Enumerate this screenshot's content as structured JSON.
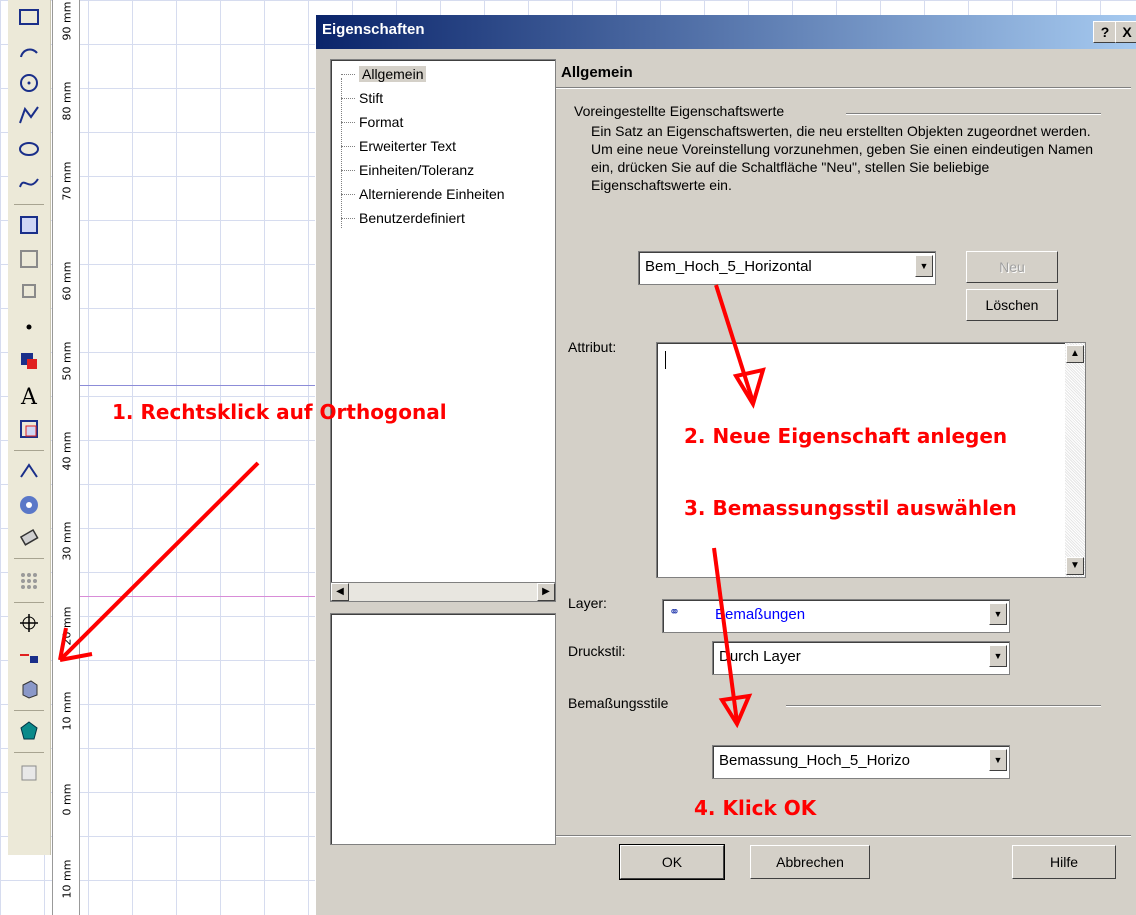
{
  "ruler": {
    "labels": [
      "90 mm",
      "80 mm",
      "70 mm",
      "60 mm",
      "50 mm",
      "40 mm",
      "30 mm",
      "20 mm",
      "10 mm",
      "0 mm",
      "10 mm"
    ]
  },
  "toolbar": {
    "icons": [
      "rectangle-icon",
      "arc-icon",
      "circle-icon",
      "polyline-icon",
      "ellipse-icon",
      "spline-icon",
      "dimension-icon",
      "dimension-edit-icon",
      "frame-icon",
      "point-icon",
      "fill-icon",
      "text-icon",
      "text-frame-icon",
      "3d-icon",
      "disc-icon",
      "eraser-icon",
      "grid-icon",
      "orthogonal-icon",
      "lock-icon",
      "cube-icon",
      "gem-icon",
      "page-icon"
    ]
  },
  "dialog": {
    "title": "Eigenschaften",
    "help_btn": "?",
    "close_btn": "X",
    "tree": [
      "Allgemein",
      "Stift",
      "Format",
      "Erweiterter Text",
      "Einheiten/Toleranz",
      "Alternierende Einheiten",
      "Benutzerdefiniert"
    ],
    "section_title": "Allgemein",
    "group_label": "Voreingestellte Eigenschaftswerte",
    "description": "Ein Satz an Eigenschaftswerten, die neu erstellten Objekten zugeordnet werden. Um eine neue Voreinstellung vorzunehmen, geben Sie einen eindeutigen Namen ein, drücken Sie auf die Schaltfläche \"Neu\", stellen Sie beliebige Eigenschaftswerte ein.",
    "preset_value": "Bem_Hoch_5_Horizontal",
    "new_btn": "Neu",
    "delete_btn": "Löschen",
    "attribute_label": "Attribut:",
    "layer_label": "Layer:",
    "layer_value": "Bemaßungen",
    "printstyle_label": "Druckstil:",
    "printstyle_value": "Durch Layer",
    "dimstyle_group": "Bemaßungsstile",
    "dimstyle_value": "Bemassung_Hoch_5_Horizo",
    "ok_btn": "OK",
    "cancel_btn": "Abbrechen",
    "help_btn_label": "Hilfe"
  },
  "annotations": {
    "step1": "1. Rechtsklick auf Orthogonal",
    "step2": "2. Neue Eigenschaft anlegen",
    "step3": "3. Bemassungsstil auswählen",
    "step4": "4. Klick OK"
  },
  "colors": {
    "annotation": "#ff0000",
    "titlebar_start": "#0a246a",
    "titlebar_end": "#a6caf0",
    "layer_text": "#0000ff"
  }
}
